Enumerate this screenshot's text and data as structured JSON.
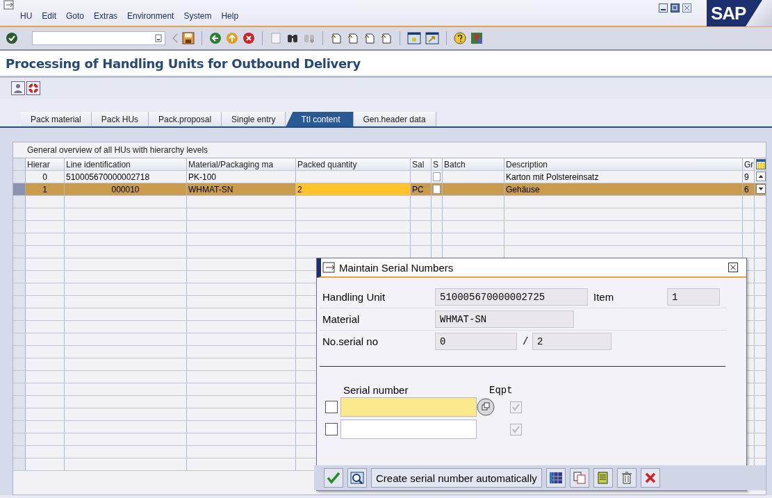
{
  "window": {
    "logo": "SAP"
  },
  "menu": [
    "HU",
    "Edit",
    "Goto",
    "Extras",
    "Environment",
    "System",
    "Help"
  ],
  "title": "Processing of Handling Units for Outbound Delivery",
  "tabs": [
    {
      "label": "Pack material",
      "selected": false
    },
    {
      "label": "Pack HUs",
      "selected": false
    },
    {
      "label": "Pack.proposal",
      "selected": false
    },
    {
      "label": "Single entry",
      "selected": false
    },
    {
      "label": "Ttl content",
      "selected": true
    },
    {
      "label": "Gen.header data",
      "selected": false
    }
  ],
  "table": {
    "title": "General overview of all HUs with hierarchy levels",
    "columns": [
      "Hierar",
      "Line identification",
      "Material/Packaging ma",
      "Packed quantity",
      "Sal",
      "S",
      "Batch",
      "Description",
      "Gr"
    ],
    "rows": [
      {
        "selected": false,
        "cells": [
          "0",
          "510005670000002718",
          "PK-100",
          "",
          "",
          "",
          "",
          "Karton mit Polstereinsatz",
          "9"
        ],
        "s_checked": false
      },
      {
        "selected": true,
        "cells": [
          "1",
          "000010",
          "WHMAT-SN",
          "2",
          "PC",
          "",
          "",
          "Gehäuse",
          "6"
        ],
        "s_checked": false
      }
    ]
  },
  "dialog": {
    "title": "Maintain Serial Numbers",
    "handling_unit": {
      "label": "Handling Unit",
      "value": "510005670000002725"
    },
    "item": {
      "label": "Item",
      "value": "1"
    },
    "material": {
      "label": "Material",
      "value": "WHMAT-SN"
    },
    "serial_count": {
      "label": "No.serial no",
      "value": "0",
      "separator": "/",
      "total": "2"
    },
    "serial_header": "Serial number",
    "equipment_header": "Eqpt",
    "serial_rows": [
      {
        "checked": false,
        "focused": true,
        "equipment": true
      },
      {
        "checked": false,
        "focused": false,
        "equipment": true
      }
    ],
    "auto_button": "Create serial number automatically"
  }
}
